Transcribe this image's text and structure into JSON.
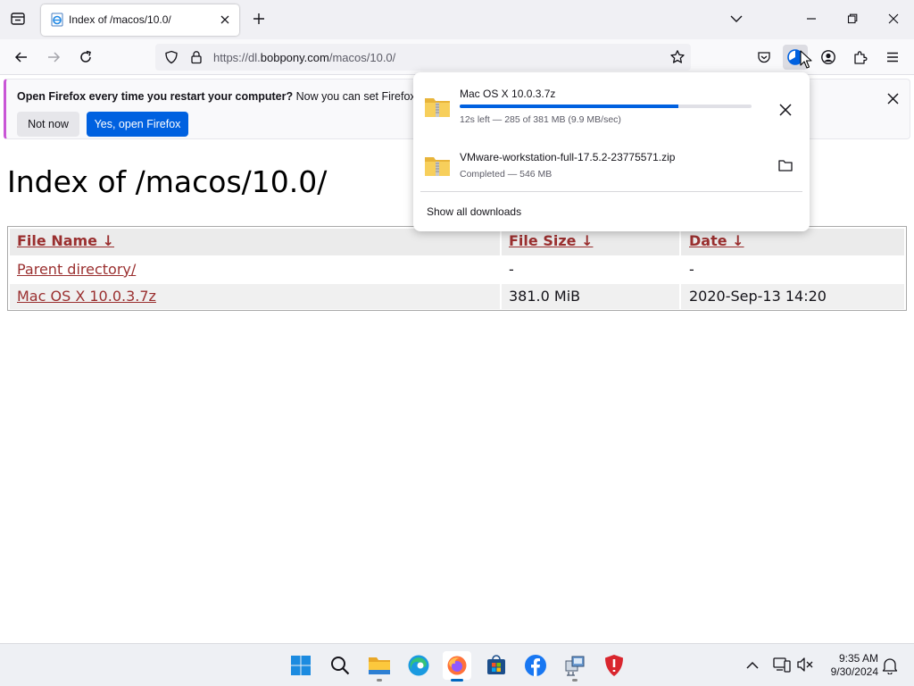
{
  "browser": {
    "tab": {
      "title": "Index of /macos/10.0/",
      "favicon": "ie-page-icon"
    },
    "url": {
      "prefix": "https://dl.",
      "domain": "bobpony.com",
      "path": "/macos/10.0/"
    },
    "toolbar_icons": [
      "back-icon",
      "forward-icon",
      "reload-icon",
      "shield-icon",
      "lock-icon",
      "star-icon",
      "pocket-icon",
      "downloads-icon",
      "account-icon",
      "extensions-icon",
      "menu-icon"
    ]
  },
  "notification": {
    "bold_text": "Open Firefox every time you restart your computer?",
    "text": " Now you can set Firefox to o",
    "not_now_label": "Not now",
    "yes_label": "Yes, open Firefox"
  },
  "page": {
    "title": "Index of /macos/10.0/",
    "columns": [
      "File Name  ↓",
      "File Size  ↓",
      "Date  ↓"
    ],
    "rows": [
      {
        "name": "Parent directory/",
        "size": "-",
        "date": "-"
      },
      {
        "name": "Mac OS X 10.0.3.7z",
        "size": "381.0 MiB",
        "date": "2020-Sep-13 14:20"
      }
    ]
  },
  "downloads": {
    "items": [
      {
        "name": "Mac OS X 10.0.3.7z",
        "status": "12s left — 285 of 381 MB (9.9 MB/sec)",
        "progress": 0.748,
        "action": "cancel-icon"
      },
      {
        "name": "VMware-workstation-full-17.5.2-23775571.zip",
        "status": "Completed — 546 MB",
        "action": "folder-icon"
      }
    ],
    "show_all_label": "Show all downloads"
  },
  "taskbar": {
    "apps": [
      "start-icon",
      "search-icon",
      "file-explorer-icon",
      "edge-icon",
      "firefox-icon",
      "store-icon",
      "facebook-icon",
      "network-app-icon",
      "security-app-icon"
    ],
    "time": "9:35 AM",
    "date": "9/30/2024"
  },
  "colors": {
    "accent": "#0061e0",
    "link": "#9a2f2f",
    "notification_stripe": "#c956d6"
  }
}
